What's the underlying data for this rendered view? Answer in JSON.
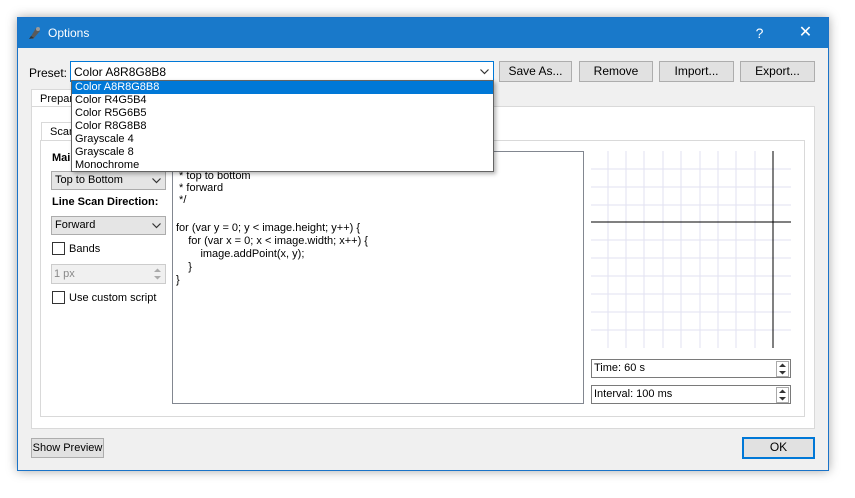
{
  "window": {
    "title": "Options"
  },
  "titlebar": {
    "help_label": "?",
    "close_label": "✕"
  },
  "preset": {
    "label": "Preset:",
    "selected": "Color A8R8G8B8",
    "options": [
      "Color A8R8G8B8",
      "Color R4G5B4",
      "Color R5G6B5",
      "Color R8G8B8",
      "Grayscale 4",
      "Grayscale 8",
      "Monochrome"
    ]
  },
  "toolbar": {
    "save_as_label": "Save As...",
    "remove_label": "Remove",
    "import_label": "Import...",
    "export_label": "Export..."
  },
  "tabs": {
    "outer_tab": "Prepar",
    "inner_tab": "Scan"
  },
  "scan": {
    "main_direction_label": "Mai",
    "main_direction_value": "Top to Bottom",
    "line_scan_label": "Line Scan Direction:",
    "line_scan_value": "Forward",
    "bands_label": "Bands",
    "bands_checked": false,
    "bands_size": "1 px",
    "custom_script_label": "Use custom script",
    "custom_script_checked": false
  },
  "script": {
    "lines": [
      " * top to bottom",
      " * forward",
      " */",
      "",
      "for (var y = 0; y < image.height; y++) {",
      "    for (var x = 0; x < image.width; x++) {",
      "        image.addPoint(x, y);",
      "    }",
      "}"
    ]
  },
  "timing": {
    "time_value": "Time: 60 s",
    "interval_value": "Interval: 100 ms"
  },
  "footer": {
    "show_preview_label": "Show Preview",
    "ok_label": "OK"
  },
  "colors": {
    "titlebar": "#1979ca",
    "selection": "#0078d7",
    "grid": "#e2e2f2"
  }
}
